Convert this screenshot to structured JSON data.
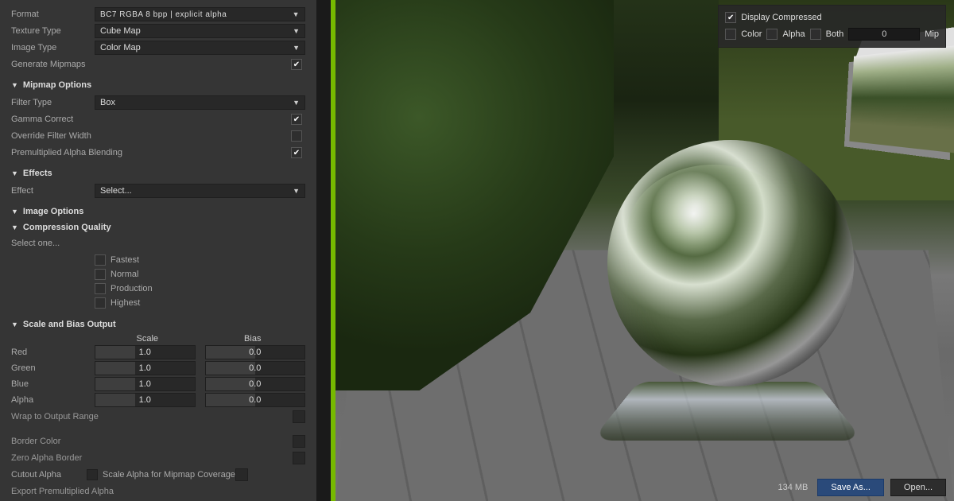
{
  "format_section": {
    "format_label": "Format",
    "format_value": "BC7     RGBA   8 bpp | explicit alpha",
    "texture_type_label": "Texture Type",
    "texture_type_value": "Cube Map",
    "image_type_label": "Image Type",
    "image_type_value": "Color Map",
    "generate_mipmaps_label": "Generate Mipmaps",
    "generate_mipmaps_checked": true
  },
  "mipmap_options": {
    "header": "Mipmap Options",
    "filter_type_label": "Filter Type",
    "filter_type_value": "Box",
    "gamma_correct_label": "Gamma Correct",
    "gamma_correct_checked": true,
    "override_filter_width_label": "Override Filter Width",
    "override_filter_width_checked": false,
    "premult_alpha_label": "Premultiplied Alpha Blending",
    "premult_alpha_checked": true
  },
  "effects": {
    "header": "Effects",
    "effect_label": "Effect",
    "effect_value": "Select..."
  },
  "image_options": {
    "header": "Image Options",
    "compression_quality_header": "Compression Quality",
    "select_one_label": "Select one...",
    "options": [
      "Fastest",
      "Normal",
      "Production",
      "Highest"
    ],
    "scale_bias_header": "Scale and Bias Output",
    "scale_col": "Scale",
    "bias_col": "Bias",
    "channels": [
      {
        "name": "Red",
        "scale": "1.0",
        "bias": "0.0"
      },
      {
        "name": "Green",
        "scale": "1.0",
        "bias": "0.0"
      },
      {
        "name": "Blue",
        "scale": "1.0",
        "bias": "0.0"
      },
      {
        "name": "Alpha",
        "scale": "1.0",
        "bias": "0.0"
      }
    ],
    "wrap_to_output_label": "Wrap to Output Range",
    "border_color_label": "Border Color",
    "zero_alpha_border_label": "Zero Alpha Border",
    "cutout_alpha_label": "Cutout Alpha",
    "scale_alpha_mip_label": "Scale Alpha for Mipmap Coverage",
    "export_premult_label": "Export Premultiplied Alpha"
  },
  "viewport": {
    "display_compressed_label": "Display Compressed",
    "display_compressed_checked": true,
    "color_label": "Color",
    "alpha_label": "Alpha",
    "both_label": "Both",
    "mip_value": "0",
    "mip_label": "Mip"
  },
  "footer": {
    "status": "134 MB",
    "save_as_label": "Save As...",
    "open_label": "Open..."
  }
}
